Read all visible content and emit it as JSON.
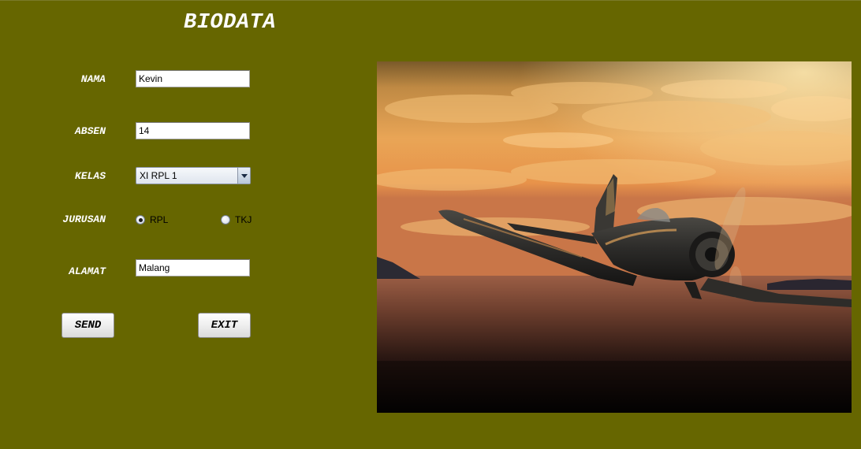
{
  "form": {
    "title": "BIODATA",
    "labels": {
      "nama": "NAMA",
      "absen": "ABSEN",
      "kelas": "KELAS",
      "jurusan": "JURUSAN",
      "alamat": "ALAMAT"
    },
    "values": {
      "nama": "Kevin",
      "absen": "14",
      "kelas": "XI RPL 1",
      "alamat": "Malang"
    },
    "jurusan_options": [
      {
        "label": "RPL",
        "checked": true
      },
      {
        "label": "TKJ",
        "checked": false
      }
    ],
    "buttons": {
      "send": "SEND",
      "exit": "EXIT"
    }
  },
  "colors": {
    "background": "#666600",
    "label_text": "#ffffff"
  },
  "image": {
    "subject": "propeller-fighter-plane-over-sea-at-sunset"
  }
}
